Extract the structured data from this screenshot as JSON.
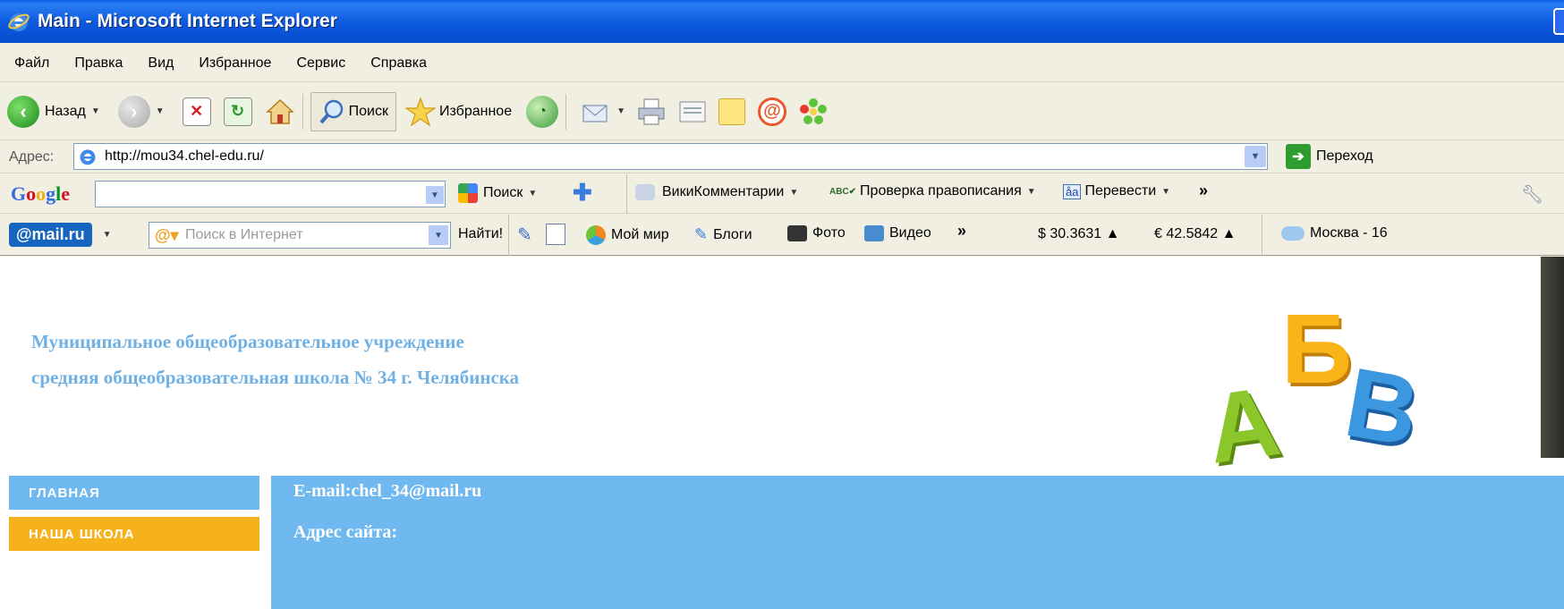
{
  "window": {
    "title": "Main - Microsoft Internet Explorer"
  },
  "menu": [
    "Файл",
    "Правка",
    "Вид",
    "Избранное",
    "Сервис",
    "Справка"
  ],
  "toolbar": {
    "back_label": "Назад",
    "search_label": "Поиск",
    "favorites_label": "Избранное"
  },
  "address": {
    "label": "Адрес:",
    "url": "http://mou34.chel-edu.ru/",
    "go_label": "Переход"
  },
  "google_bar": {
    "logo": "Google",
    "search_btn": "Поиск",
    "wiki_comments": "ВикиКомментарии",
    "spellcheck": "Проверка правописания",
    "translate": "Перевести",
    "more": "»"
  },
  "mail_bar": {
    "logo": "@mail.ru",
    "search_placeholder": "Поиск в Интернет",
    "find_btn": "Найти!",
    "moy_mir": "Мой мир",
    "blogs": "Блоги",
    "photo": "Фото",
    "video": "Видео",
    "more": "»",
    "usd_rate": "$ 30.3631 ▲",
    "eur_rate": "€ 42.5842 ▲",
    "weather": "Москва - 16"
  },
  "page": {
    "school_line1": "Муниципальное общеобразовательное учреждение",
    "school_line2": "средняя общеобразовательная школа № 34 г. Челябинска",
    "logo_letters": [
      "А",
      "Б",
      "В"
    ],
    "nav": [
      {
        "label": "ГЛАВНАЯ",
        "color": "#6fb8f0"
      },
      {
        "label": "НАША ШКОЛА",
        "color": "#f6b21c"
      }
    ],
    "email": "E-mail:chel_34@mail.ru",
    "site_address": "Адрес сайта:"
  },
  "colors": {
    "title_blue": "#6fb1e4",
    "nav_blue": "#6fb8f0",
    "nav_orange": "#f6b21c",
    "titlebar_blue": "#0b58dc"
  }
}
